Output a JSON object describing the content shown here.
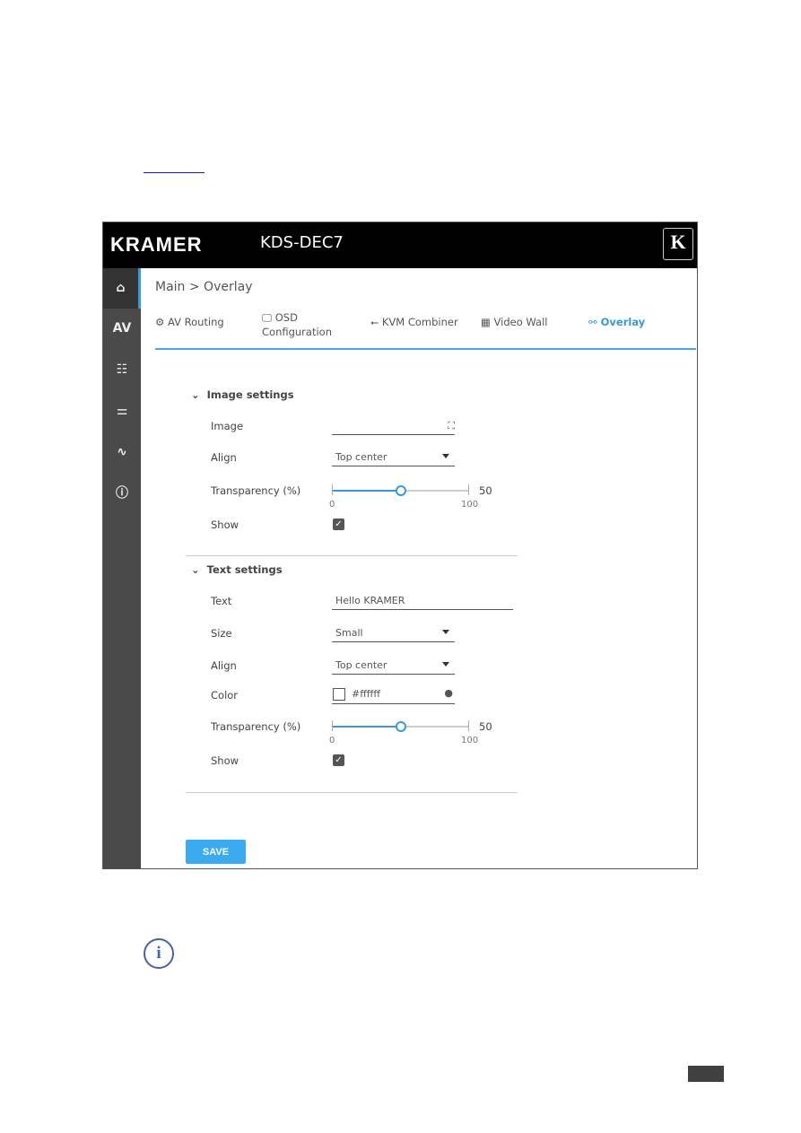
{
  "header": {
    "brand": "KRAMER",
    "model": "KDS-DEC7",
    "logo_letter": "K"
  },
  "sidebar": {
    "items": [
      {
        "icon": "home-icon",
        "glyph": "⌂"
      },
      {
        "icon": "av-icon",
        "glyph": "AV"
      },
      {
        "icon": "settings-list-icon",
        "glyph": "☷"
      },
      {
        "icon": "sliders-icon",
        "glyph": "⚌"
      },
      {
        "icon": "diagnostics-icon",
        "glyph": "∿"
      },
      {
        "icon": "info-icon",
        "glyph": "ⓘ"
      }
    ],
    "accent": "#3a9ad9"
  },
  "breadcrumb": "Main > Overlay",
  "tabs": [
    {
      "label": "AV Routing",
      "icon": "gear-icon",
      "glyph": "⚙"
    },
    {
      "label": "OSD",
      "label2": "Configuration",
      "icon": "monitor-icon",
      "glyph": "🖵"
    },
    {
      "label": "KVM Combiner",
      "icon": "usb-icon",
      "glyph": "⭠"
    },
    {
      "label": "Video Wall",
      "icon": "grid-icon",
      "glyph": "▦"
    },
    {
      "label": "Overlay",
      "icon": "overlay-icon",
      "glyph": "⚯",
      "active": true
    }
  ],
  "image_settings": {
    "title": "Image settings",
    "image_label": "Image",
    "image_value": "",
    "align_label": "Align",
    "align_value": "Top center",
    "transparency_label": "Transparency (%)",
    "transparency_value": "50",
    "min": "0",
    "max": "100",
    "show_label": "Show",
    "show_checked": true
  },
  "text_settings": {
    "title": "Text settings",
    "text_label": "Text",
    "text_value": "Hello KRAMER",
    "size_label": "Size",
    "size_value": "Small",
    "align_label": "Align",
    "align_value": "Top center",
    "color_label": "Color",
    "color_value": "#ffffff",
    "transparency_label": "Transparency (%)",
    "transparency_value": "50",
    "min": "0",
    "max": "100",
    "show_label": "Show",
    "show_checked": true
  },
  "save_label": "SAVE",
  "note_icon": "info-icon"
}
